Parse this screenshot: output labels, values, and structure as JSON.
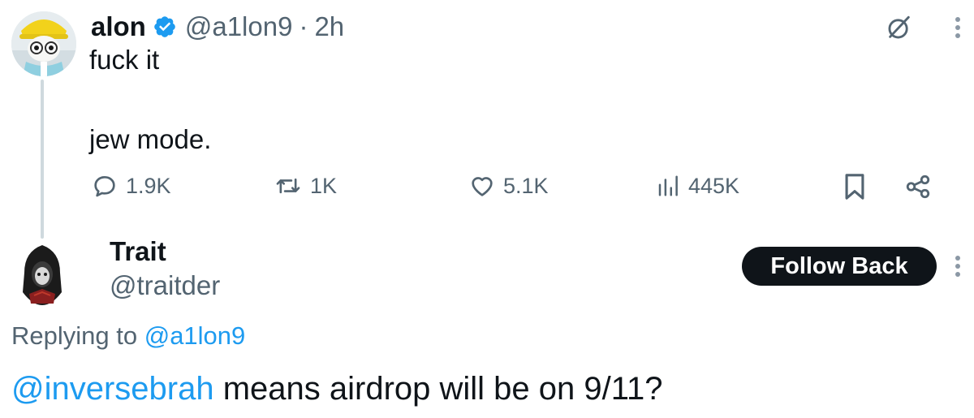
{
  "tweet": {
    "author": {
      "name": "alon",
      "handle": "@a1lon9",
      "time": "2h",
      "verified": true,
      "separator": "·"
    },
    "text_lines": [
      "fuck it",
      "jew mode."
    ],
    "stats": {
      "replies": "1.9K",
      "retweets": "1K",
      "likes": "5.1K",
      "views": "445K"
    },
    "icons": {
      "reply": "reply-icon",
      "retweet": "retweet-icon",
      "like": "heart-icon",
      "views": "views-icon",
      "bookmark": "bookmark-icon",
      "share": "share-icon",
      "grok": "grok-icon",
      "more": "more-icon"
    }
  },
  "reply": {
    "author": {
      "name": "Trait",
      "handle": "@traitder"
    },
    "follow_label": "Follow Back",
    "replying_prefix": "Replying to",
    "replying_handle": "@a1lon9",
    "mention": "@inversebrah",
    "text": " means airdrop will be on 9/11?"
  },
  "colors": {
    "text": "#0f1419",
    "secondary": "#536471",
    "link": "#1d9bf0",
    "verified": "#1d9bf0",
    "button_bg": "#0f1419",
    "button_text": "#ffffff"
  }
}
